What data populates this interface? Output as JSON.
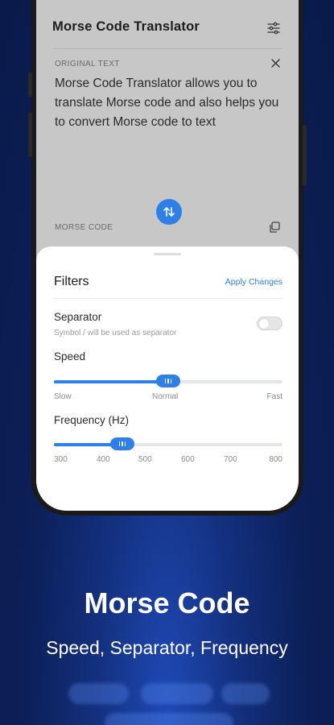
{
  "app": {
    "title": "Morse Code Translator"
  },
  "original": {
    "label": "ORIGINAL TEXT",
    "text": "Morse Code Translator allows you to translate Morse code and also helps you to convert Morse code to text"
  },
  "morse": {
    "label": "MORSE CODE"
  },
  "filters": {
    "title": "Filters",
    "apply_label": "Apply Changes",
    "separator": {
      "label": "Separator",
      "hint": "Symbol / will be used as separator",
      "enabled": false
    },
    "speed": {
      "label": "Speed",
      "value": "Normal",
      "position": 0.5,
      "marks": [
        "Slow",
        "Normal",
        "Fast"
      ]
    },
    "frequency": {
      "label": "Frequency (Hz)",
      "value": 450,
      "min": 300,
      "max": 800,
      "ticks": [
        "300",
        "400",
        "500",
        "600",
        "700",
        "800"
      ]
    }
  },
  "hero": {
    "headline": "Morse Code",
    "subhead": "Speed, Separator, Frequency"
  },
  "colors": {
    "accent": "#2f7fe8",
    "background": "#0c1f57"
  },
  "icons": [
    "filter-settings-icon",
    "close-icon",
    "swap-icon",
    "copy-icon"
  ]
}
